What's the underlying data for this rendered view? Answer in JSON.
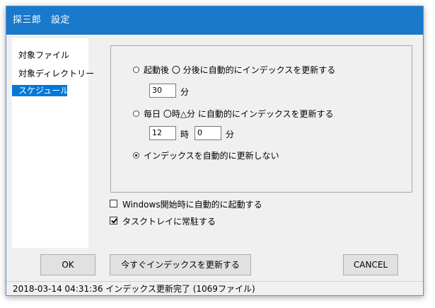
{
  "window": {
    "title": "探三郎　設定"
  },
  "sidebar": {
    "items": [
      {
        "label": "対象ファイル",
        "selected": false
      },
      {
        "label": "対象ディレクトリー",
        "selected": false
      },
      {
        "label": "スケジュール",
        "selected": true
      }
    ]
  },
  "schedule": {
    "option1": {
      "label": "起動後 〇 分後に自動的にインデックスを更新する",
      "selected": false,
      "minutes_value": "30",
      "unit": "分"
    },
    "option2": {
      "label": "毎日  〇時△分 に自動的にインデックスを更新する",
      "selected": false,
      "hour_value": "12",
      "hour_unit": "時",
      "minute_value": "0",
      "minute_unit": "分"
    },
    "option3": {
      "label": "インデックスを自動的に更新しない",
      "selected": true
    }
  },
  "options": {
    "autostart": {
      "label": "Windows開始時に自動的に起動する",
      "checked": false
    },
    "tray": {
      "label": "タスクトレイに常駐する",
      "checked": true
    }
  },
  "buttons": {
    "ok": "OK",
    "update_now": "今すぐインデックスを更新する",
    "cancel": "CANCEL"
  },
  "status": {
    "text": "2018-03-14 04:31:36  インデックス更新完了 (1069ファイル)"
  },
  "colors": {
    "title_bar": "#1979ca",
    "selection": "#0078d7",
    "background": "#f0f0f0"
  }
}
